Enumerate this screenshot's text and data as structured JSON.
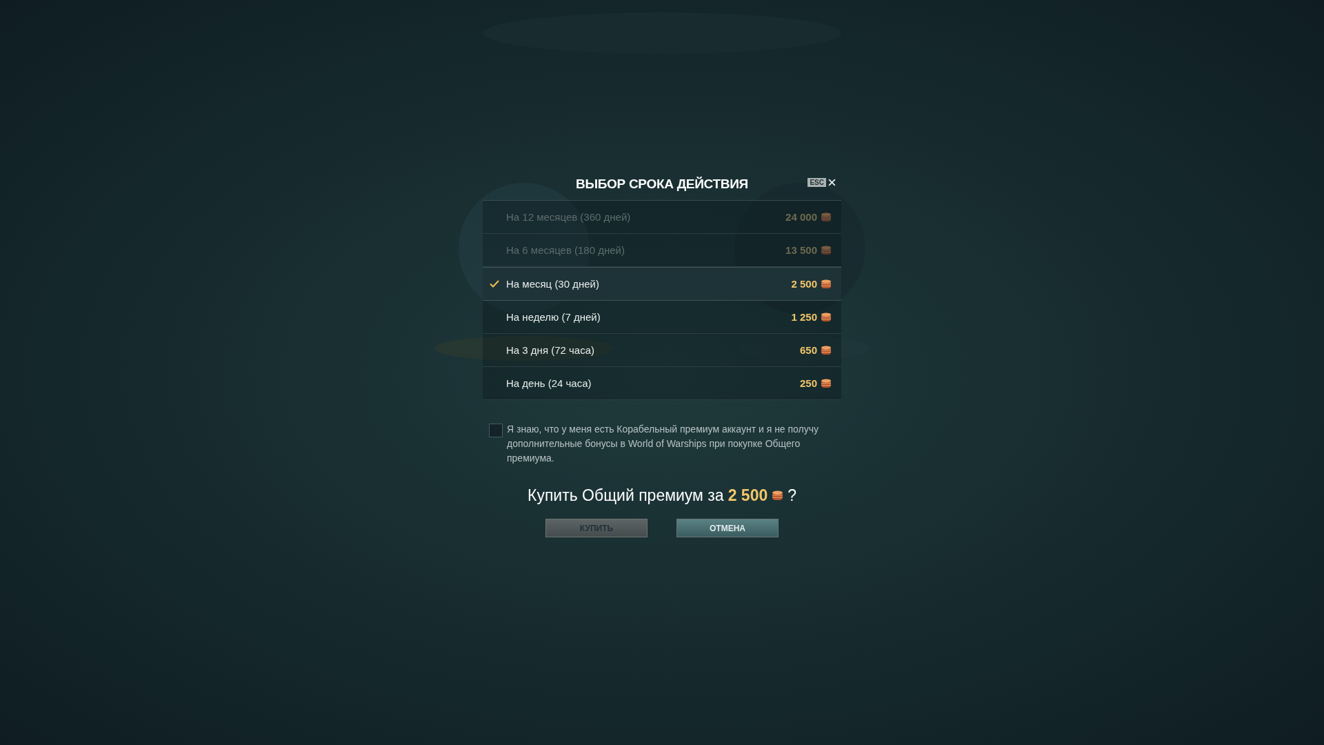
{
  "dialog": {
    "title": "ВЫБОР СРОКА ДЕЙСТВИЯ",
    "esc_hint": "ESC",
    "options": [
      {
        "label": "На 12 месяцев (360 дней)",
        "price": "24 000",
        "disabled": true,
        "selected": false
      },
      {
        "label": "На 6 месяцев (180 дней)",
        "price": "13 500",
        "disabled": true,
        "selected": false
      },
      {
        "label": "На месяц (30 дней)",
        "price": "2 500",
        "disabled": false,
        "selected": true
      },
      {
        "label": "На неделю (7 дней)",
        "price": "1 250",
        "disabled": false,
        "selected": false
      },
      {
        "label": "На 3 дня (72 часа)",
        "price": "650",
        "disabled": false,
        "selected": false
      },
      {
        "label": "На день (24 часа)",
        "price": "250",
        "disabled": false,
        "selected": false
      }
    ],
    "agreement": {
      "checked": false,
      "text": "Я знаю, что у меня есть Корабельный премиум аккаунт и я не получу дополнительные бонусы в World of Warships при покупке Общего премиума."
    },
    "question": {
      "text": "Купить Общий премиум за",
      "price": "2 500",
      "suffix": "?"
    },
    "buttons": [
      {
        "label": "КУПИТЬ",
        "kind": "confirm",
        "disabled": true
      },
      {
        "label": "ОТМЕНА",
        "kind": "cancel",
        "disabled": false
      }
    ]
  }
}
